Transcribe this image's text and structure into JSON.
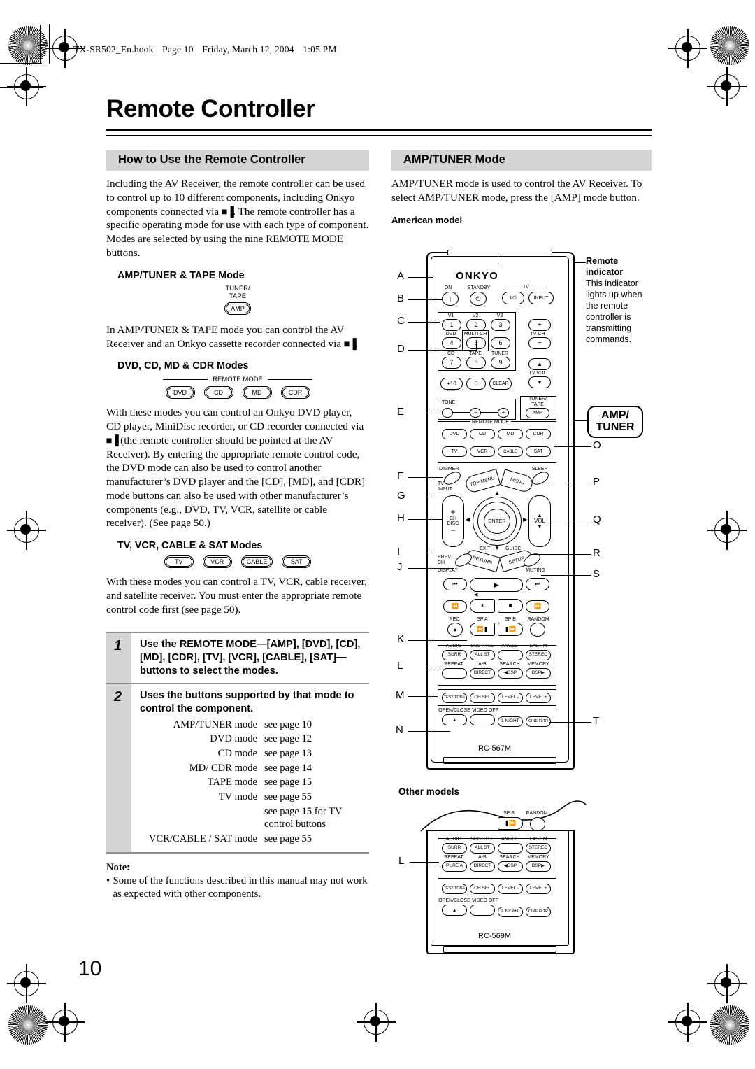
{
  "header": {
    "file_line": [
      "TX-SR502_En.book",
      "Page 10",
      "Friday, March 12, 2004",
      "1:05 PM"
    ]
  },
  "page_title": "Remote Controller",
  "page_number": "10",
  "left_column": {
    "section_title": "How to Use the Remote Controller",
    "intro": "Including the AV Receiver, the remote controller can be used to control up to 10 different components, including Onkyo components connected via Rı. The remote controller has a specific operating mode for use with each type of component. Modes are selected by using the nine REMOTE MODE buttons.",
    "sub1_title": "AMP/TUNER & TAPE Mode",
    "sub1_button_label_line1": "TUNER/",
    "sub1_button_label_line2": "TAPE",
    "sub1_button": "AMP",
    "sub1_body": "In AMP/TUNER & TAPE mode you can control the AV Receiver and an Onkyo cassette recorder connected via Rı.",
    "sub2_title": "DVD, CD, MD & CDR Modes",
    "remote_mode_caption": "REMOTE MODE",
    "sub2_buttons": [
      "DVD",
      "CD",
      "MD",
      "CDR"
    ],
    "sub2_body": "With these modes you can control an Onkyo DVD player, CD player, MiniDisc recorder, or CD recorder connected via Rı (the remote controller should be pointed at the AV Receiver). By entering the appropriate remote control code, the DVD mode can also be used to control another manufacturer’s DVD player and the [CD], [MD], and [CDR] mode buttons can also be used with other manufacturer’s components (e.g., DVD, TV, VCR, satellite or cable receiver). (See page 50.)",
    "sub3_title": "TV, VCR, CABLE & SAT Modes",
    "sub3_buttons": [
      "TV",
      "VCR",
      "CABLE",
      "SAT"
    ],
    "sub3_body": "With these modes you can control a TV, VCR, cable receiver, and satellite receiver. You must enter the appropriate remote control code first (see page 50).",
    "steps": [
      {
        "num": "1",
        "text": "Use the REMOTE MODE—[AMP], [DVD], [CD], [MD], [CDR], [TV], [VCR], [CABLE], [SAT]— buttons to select the modes."
      },
      {
        "num": "2",
        "text": "Uses the buttons supported by that mode to control the component."
      }
    ],
    "mode_table": [
      {
        "mode": "AMP/TUNER mode",
        "ref": "see page 10"
      },
      {
        "mode": "DVD mode",
        "ref": "see page 12"
      },
      {
        "mode": "CD mode",
        "ref": "see page 13"
      },
      {
        "mode": "MD/ CDR mode",
        "ref": "see page 14"
      },
      {
        "mode": "TAPE mode",
        "ref": "see page 15"
      },
      {
        "mode": "TV mode",
        "ref": "see page 55"
      },
      {
        "mode": "",
        "ref": "see page 15 for TV control buttons"
      },
      {
        "mode": "VCR/CABLE / SAT mode",
        "ref": "see page 55"
      }
    ],
    "note_heading": "Note:",
    "note_items": [
      "Some of the functions described in this manual may not work as expected with other components."
    ]
  },
  "right_column": {
    "section_title": "AMP/TUNER Mode",
    "intro": "AMP/TUNER mode is used to control the AV Receiver. To select AMP/TUNER mode, press the [AMP] mode button.",
    "american_model_caption": "American model",
    "other_models_caption": "Other models",
    "remote_indicator": {
      "title_line1": "Remote",
      "title_line2": "indicator",
      "body": "This indicator lights up when the remote controller is transmitting commands."
    },
    "amp_tuner_big": {
      "line1": "AMP/",
      "line2": "TUNER"
    },
    "model_names": {
      "american": "RC-567M",
      "other": "RC-569M"
    },
    "callouts_left": [
      "A",
      "B",
      "C",
      "D",
      "E",
      "F",
      "G",
      "H",
      "I",
      "J",
      "K",
      "L",
      "M",
      "N"
    ],
    "callouts_right": [
      "O",
      "P",
      "Q",
      "R",
      "S",
      "T"
    ],
    "callout_other_models": "L"
  },
  "remote": {
    "brand": "ONKYO",
    "labels": {
      "on": "ON",
      "standby": "STANDBY",
      "tv": "TV",
      "tv_power": "I/⏻",
      "input": "INPUT",
      "v1": "V1",
      "v2": "V2",
      "v3": "V3",
      "dvd": "DVD",
      "multi_ch": "MULTI CH",
      "cd": "CD",
      "tape": "TAPE",
      "tuner": "TUNER",
      "tv_ch": "TV CH",
      "tv_vol": "TV VOL",
      "tone": "TONE",
      "tuner_tape": "TUNER/",
      "tuner_tape2": "TAPE",
      "amp": "AMP",
      "remote_mode": "REMOTE MODE",
      "dimmer": "DIMMER",
      "tv_input1": "TV",
      "tv_input2": "INPUT",
      "sleep": "SLEEP",
      "top_menu": "TOP MENU",
      "menu": "MENU",
      "ch": "CH",
      "disc": "DISC",
      "enter": "ENTER",
      "vol": "VOL",
      "exit": "EXIT",
      "guide": "GUIDE",
      "return": "RETURN",
      "setup": "SETUP",
      "prev": "PREV",
      "prev_ch": "CH",
      "display": "DISPLAY",
      "muting": "MUTING",
      "rec": "REC",
      "sp_a": "SP A",
      "sp_b": "SP B",
      "random": "RANDOM",
      "audio": "AUDIO",
      "subtitle": "SUBTITLE",
      "angle": "ANGLE",
      "last_m": "LAST M",
      "repeat": "REPEAT",
      "ab": "A-B",
      "search": "SEARCH",
      "memory": "MEMORY",
      "open_close": "OPEN/CLOSE",
      "video_off": "VIDEO OFF"
    },
    "numpad": [
      "1",
      "2",
      "3",
      "4",
      "5",
      "6",
      "7",
      "8",
      "9",
      "+10",
      "0",
      "CLEAR"
    ],
    "mode_row1": [
      "DVD",
      "CD",
      "MD",
      "CDR"
    ],
    "mode_row2": [
      "TV",
      "VCR",
      "CABLE",
      "SAT"
    ],
    "dsp_row1": [
      "SURR",
      "ALL ST",
      "",
      "STEREO"
    ],
    "dsp_row2": [
      "",
      "DIRECT",
      "◀ DSP",
      "DSP ▶"
    ],
    "level_row": [
      "TEST TONE",
      "CH SEL",
      "LEVEL -",
      "LEVEL +"
    ],
    "bottom_row": [
      "⏏",
      "",
      "L NIGHT",
      "CINE FLTR"
    ],
    "other_dsp_row2": [
      "PURE A",
      "DIRECT",
      "◀ DSP",
      "DSP ▶"
    ]
  }
}
